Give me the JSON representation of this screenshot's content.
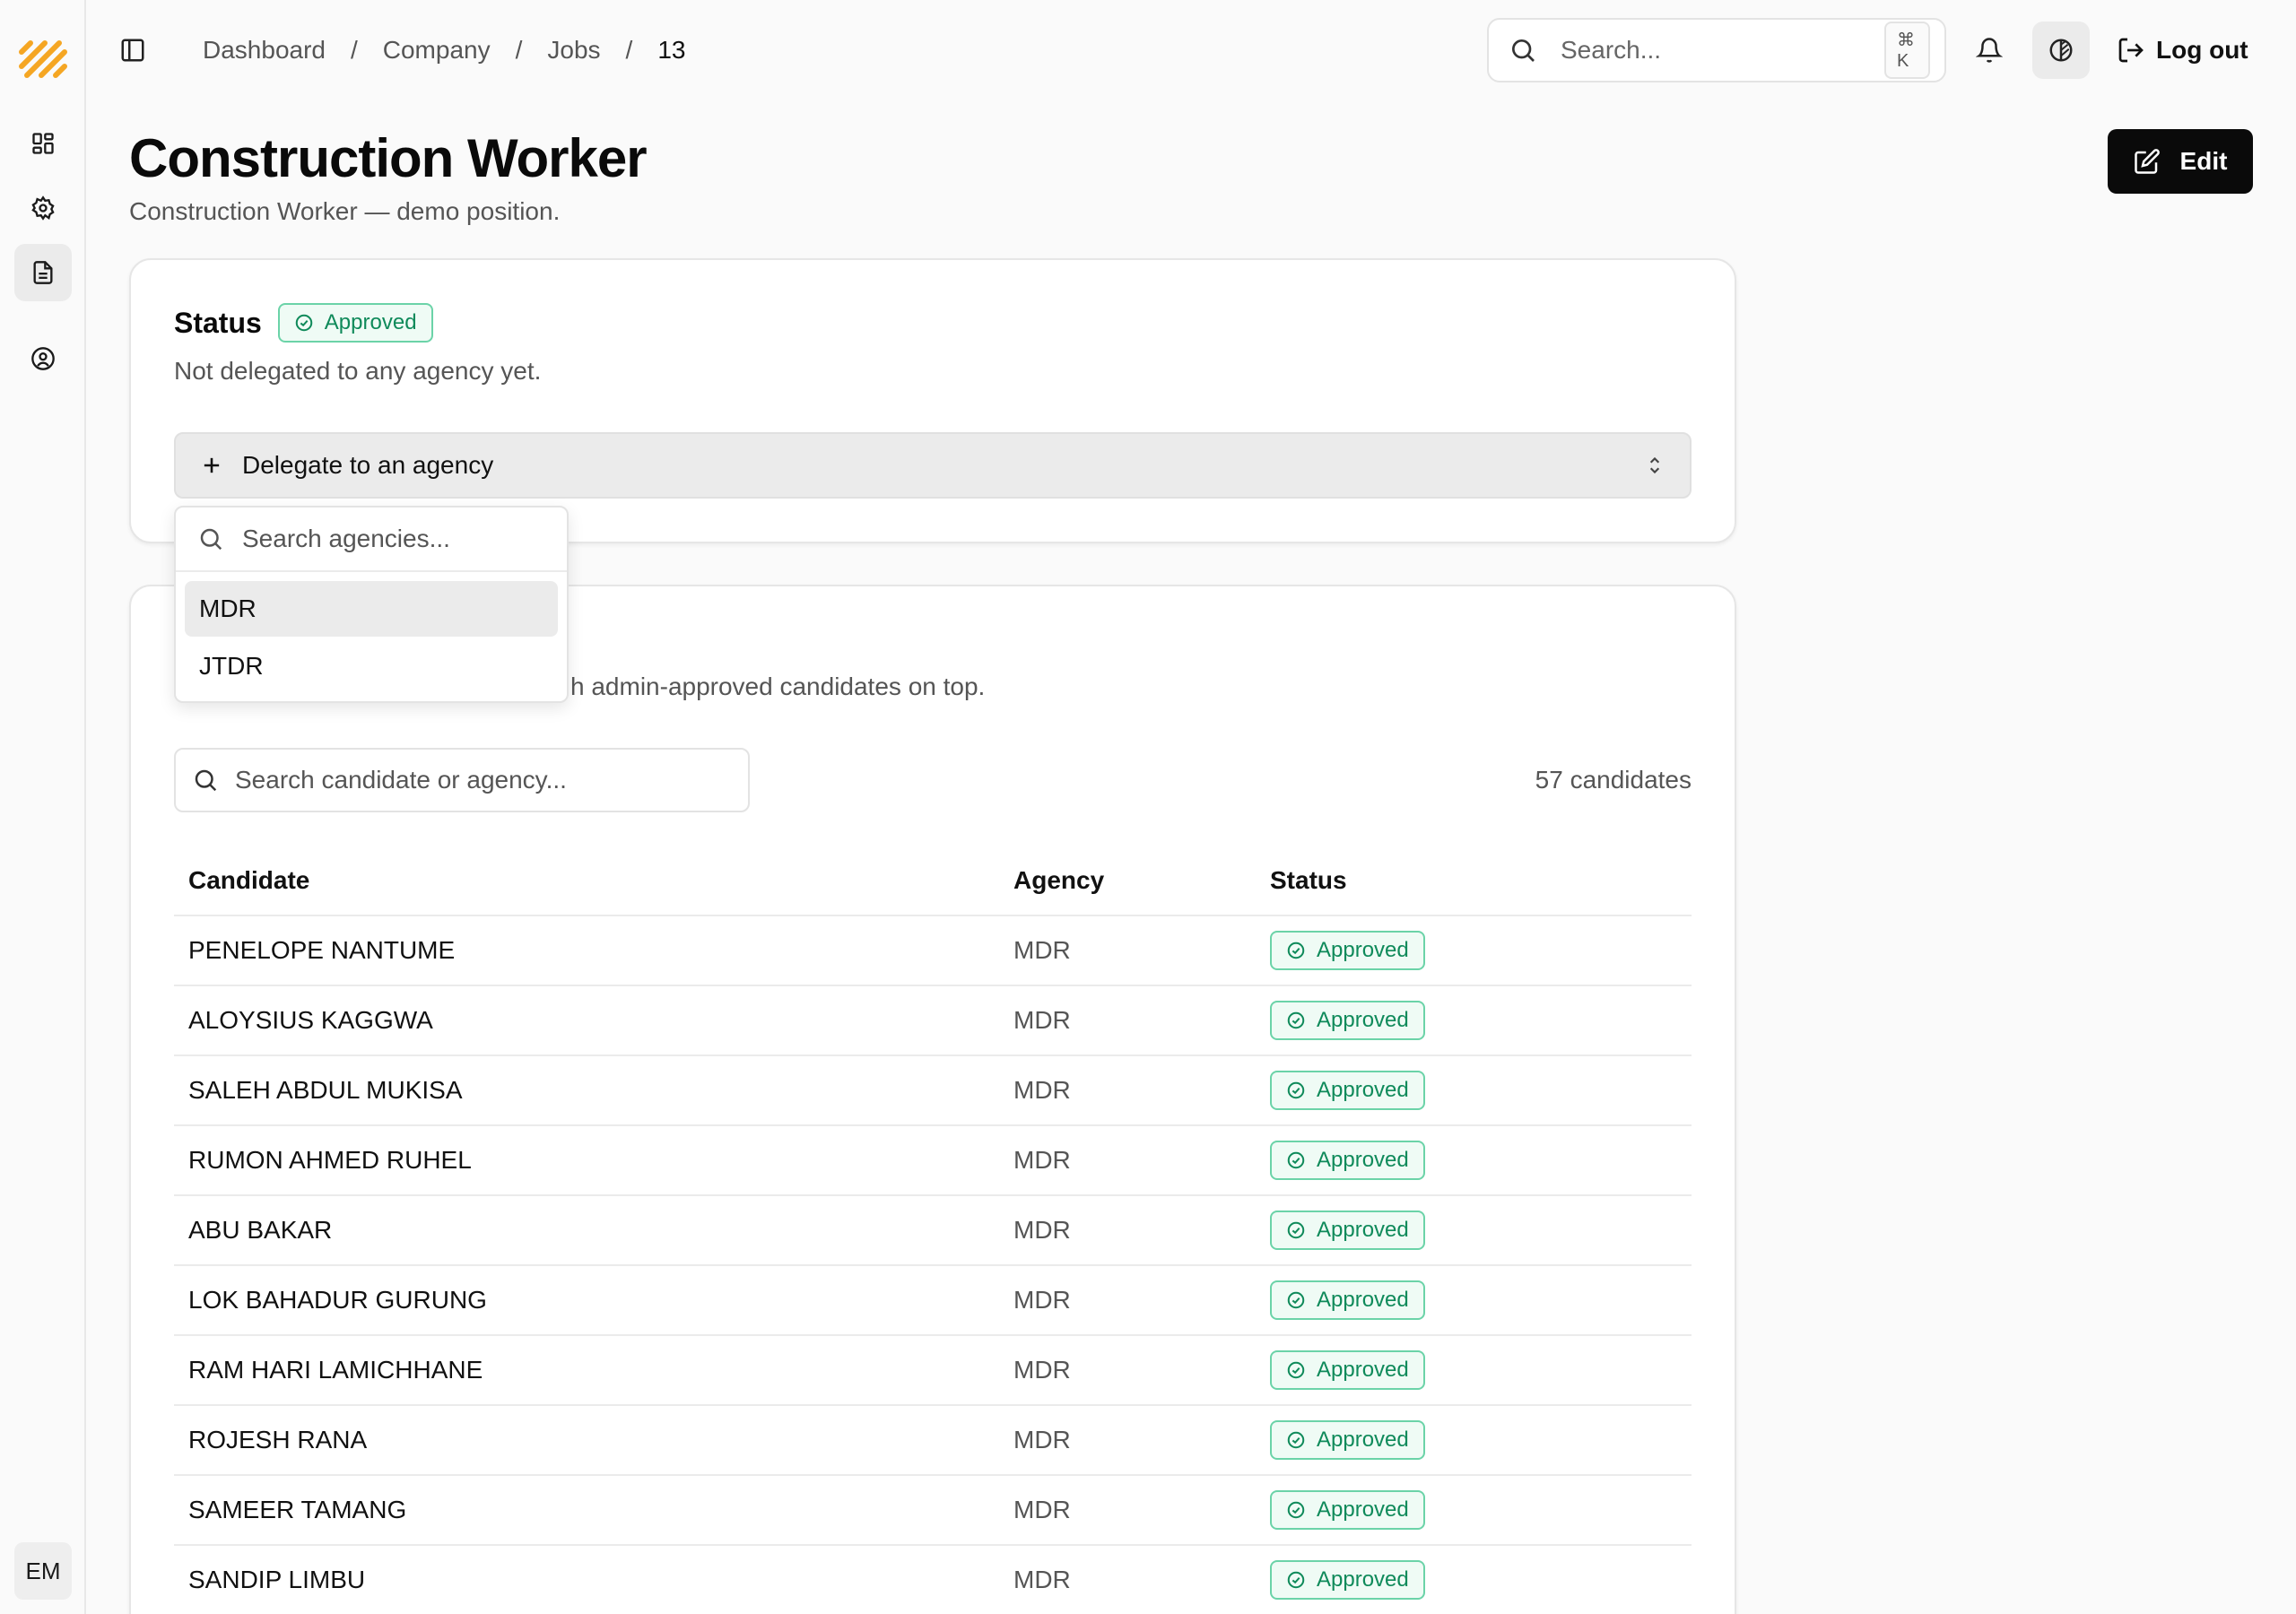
{
  "sidebar": {
    "items": [
      {
        "name": "dashboard"
      },
      {
        "name": "settings"
      },
      {
        "name": "jobs",
        "active": true
      },
      {
        "name": "profile"
      }
    ],
    "avatar_initials": "EM"
  },
  "header": {
    "breadcrumb": [
      "Dashboard",
      "Company",
      "Jobs",
      "13"
    ],
    "search_placeholder": "Search...",
    "search_shortcut": "⌘ K",
    "logout_label": "Log out"
  },
  "page": {
    "title": "Construction Worker",
    "subtitle": "Construction Worker — demo position.",
    "edit_label": "Edit"
  },
  "status_card": {
    "title": "Status",
    "badge": "Approved",
    "description": "Not delegated to any agency yet.",
    "delegate_label": "Delegate to an agency"
  },
  "delegate_dropdown": {
    "search_placeholder": "Search agencies...",
    "options": [
      "MDR",
      "JTDR"
    ],
    "highlighted": "MDR"
  },
  "candidates_card": {
    "description_visible": "h admin-approved candidates on top.",
    "search_placeholder": "Search candidate or agency...",
    "count_label": "57 candidates",
    "columns": [
      "Candidate",
      "Agency",
      "Status"
    ],
    "rows": [
      {
        "name": "PENELOPE NANTUME",
        "agency": "MDR",
        "status": "Approved"
      },
      {
        "name": "ALOYSIUS KAGGWA",
        "agency": "MDR",
        "status": "Approved"
      },
      {
        "name": "SALEH ABDUL MUKISA",
        "agency": "MDR",
        "status": "Approved"
      },
      {
        "name": "RUMON AHMED RUHEL",
        "agency": "MDR",
        "status": "Approved"
      },
      {
        "name": "ABU BAKAR",
        "agency": "MDR",
        "status": "Approved"
      },
      {
        "name": "LOK BAHADUR GURUNG",
        "agency": "MDR",
        "status": "Approved"
      },
      {
        "name": "RAM HARI LAMICHHANE",
        "agency": "MDR",
        "status": "Approved"
      },
      {
        "name": "ROJESH RANA",
        "agency": "MDR",
        "status": "Approved"
      },
      {
        "name": "SAMEER TAMANG",
        "agency": "MDR",
        "status": "Approved"
      },
      {
        "name": "SANDIP LIMBU",
        "agency": "MDR",
        "status": "Approved"
      }
    ]
  },
  "colors": {
    "accent_logo": "#f5a623",
    "approved_text": "#0f8a5a",
    "approved_border": "#6bd3a8",
    "primary_button": "#0a0a0a"
  }
}
